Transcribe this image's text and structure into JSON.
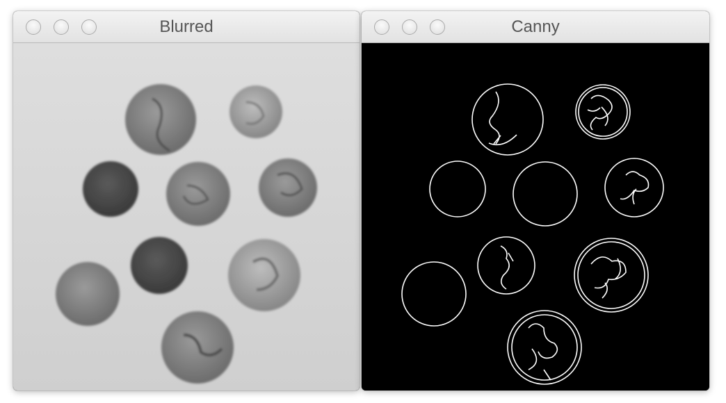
{
  "windows": [
    {
      "title": "Blurred",
      "colors": {
        "background": "#c9c9c9",
        "coin": "#5f5f5f"
      }
    },
    {
      "title": "Canny",
      "colors": {
        "background": "#000000",
        "edge": "#ffffff"
      }
    }
  ],
  "icons": {
    "traffic_lights": [
      "close-button",
      "minimize-button",
      "zoom-button"
    ],
    "coin_icon": "coin-icon"
  }
}
